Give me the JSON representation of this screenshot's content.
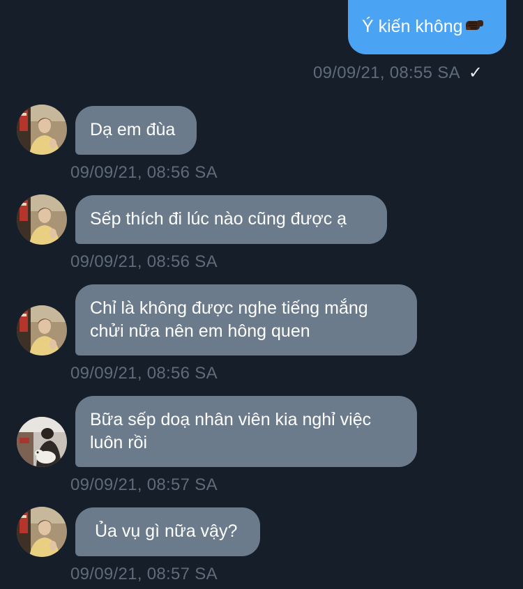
{
  "messages": [
    {
      "direction": "sent",
      "text": "Ý kiến không",
      "emoji": "fist-emoji",
      "timestamp": "09/09/21, 08:55 SA",
      "status_icon": "check-icon",
      "status": "✓"
    },
    {
      "direction": "received",
      "lines": [
        "Dạ em đùa"
      ],
      "timestamp": "09/09/21, 08:56 SA",
      "avatar": "avatar-man-yellow-shirt"
    },
    {
      "direction": "received",
      "lines": [
        "Sếp thích đi lúc nào cũng được ạ"
      ],
      "timestamp": "09/09/21, 08:56 SA",
      "avatar": "avatar-man-yellow-shirt"
    },
    {
      "direction": "received",
      "lines": [
        "Chỉ là không được nghe tiếng mắng",
        "chửi nữa nên em hông quen"
      ],
      "timestamp": "09/09/21, 08:56 SA",
      "avatar": "avatar-man-yellow-shirt"
    },
    {
      "direction": "received",
      "lines": [
        "Bữa sếp doạ nhân viên kia nghỉ việc",
        "luôn rồi"
      ],
      "timestamp": "09/09/21, 08:57 SA",
      "avatar": "avatar-person-with-dog"
    },
    {
      "direction": "received",
      "lines": [
        "Ủa vụ gì nữa vậy?"
      ],
      "timestamp": "09/09/21, 08:57 SA",
      "avatar": "avatar-man-yellow-shirt"
    }
  ],
  "colors": {
    "background": "#161e29",
    "sent_bubble": "#4ba3f3",
    "received_bubble": "#6b7b8c",
    "timestamp": "#5f6b79",
    "text": "#ffffff"
  }
}
